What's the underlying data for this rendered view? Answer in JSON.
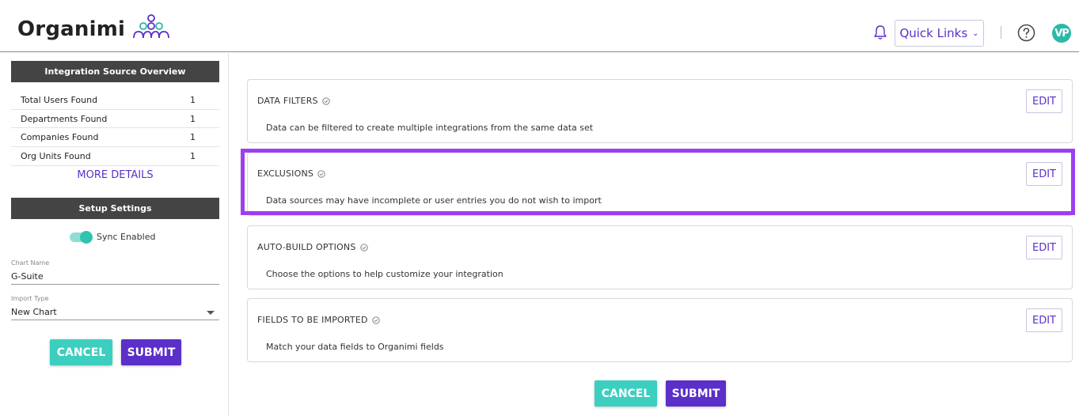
{
  "header": {
    "logo_text": "Organimi",
    "quick_links_label": "Quick Links",
    "avatar_initials": "VP",
    "colors": {
      "brand": "#5b2fc9",
      "teal": "#2bb9a7"
    }
  },
  "sidebar": {
    "overview_title": "Integration Source Overview",
    "stats": [
      {
        "label": "Total Users Found",
        "value": "1"
      },
      {
        "label": "Departments Found",
        "value": "1"
      },
      {
        "label": "Companies Found",
        "value": "1"
      },
      {
        "label": "Org Units Found",
        "value": "1"
      }
    ],
    "more_details_label": "MORE DETAILS",
    "setup_title": "Setup Settings",
    "sync_label": "Sync Enabled",
    "sync_enabled": true,
    "chart_name_label": "Chart Name",
    "chart_name_value": "G-Suite",
    "import_type_label": "Import Type",
    "import_type_value": "New Chart",
    "cancel_label": "CANCEL",
    "submit_label": "SUBMIT"
  },
  "main": {
    "cards": [
      {
        "title": "DATA FILTERS",
        "description": "Data can be filtered to create multiple integrations from the same data set",
        "edit_label": "EDIT"
      },
      {
        "title": "EXCLUSIONS",
        "description": "Data sources may have incomplete or user entries you do not wish to import",
        "edit_label": "EDIT",
        "highlighted": true
      },
      {
        "title": "AUTO-BUILD OPTIONS",
        "description": "Choose the options to help customize your integration",
        "edit_label": "EDIT"
      },
      {
        "title": "FIELDS TO BE IMPORTED",
        "description": "Match your data fields to Organimi fields",
        "edit_label": "EDIT"
      }
    ],
    "cancel_label": "CANCEL",
    "submit_label": "SUBMIT"
  }
}
